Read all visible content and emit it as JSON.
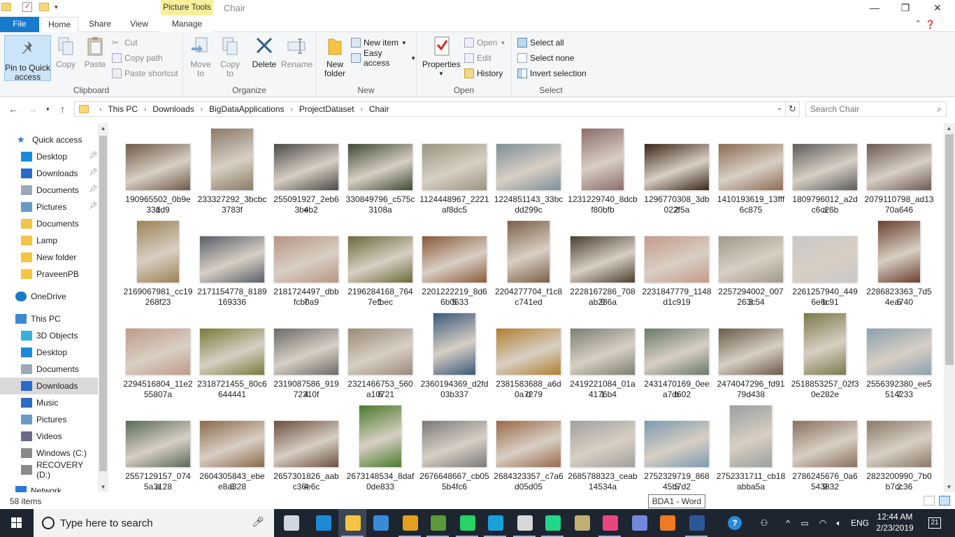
{
  "window": {
    "title": "Chair",
    "context_tab": "Picture Tools",
    "controls": {
      "minimize": "—",
      "maximize": "❐",
      "close": "✕"
    }
  },
  "ribbon_tabs": [
    {
      "label": "File"
    },
    {
      "label": "Home"
    },
    {
      "label": "Share"
    },
    {
      "label": "View"
    },
    {
      "label": "Manage"
    }
  ],
  "ribbon": {
    "clipboard": {
      "title": "Clipboard",
      "pin_label_1": "Pin to Quick",
      "pin_label_2": "access",
      "copy": "Copy",
      "paste": "Paste",
      "cut": "Cut",
      "copy_path": "Copy path",
      "paste_shortcut": "Paste shortcut"
    },
    "organize": {
      "title": "Organize",
      "move_1": "Move",
      "move_2": "to",
      "copy_1": "Copy",
      "copy_2": "to",
      "delete": "Delete",
      "rename": "Rename"
    },
    "new": {
      "title": "New",
      "new_folder_1": "New",
      "new_folder_2": "folder",
      "new_item": "New item",
      "easy_access": "Easy access"
    },
    "open": {
      "title": "Open",
      "properties": "Properties",
      "open": "Open",
      "edit": "Edit",
      "history": "History"
    },
    "select": {
      "title": "Select",
      "select_all": "Select all",
      "select_none": "Select none",
      "invert": "Invert selection"
    }
  },
  "address": {
    "crumbs": [
      "This PC",
      "Downloads",
      "BigDataApplications",
      "ProjectDataset",
      "Chair"
    ],
    "search_placeholder": "Search Chair"
  },
  "nav": {
    "items": [
      {
        "label": "Quick access",
        "icon": "star-icon",
        "pinned": false,
        "selected": false
      },
      {
        "label": "Desktop",
        "icon": "desktop-icon",
        "pinned": true,
        "selected": false
      },
      {
        "label": "Downloads",
        "icon": "download-icon",
        "pinned": true,
        "selected": false
      },
      {
        "label": "Documents",
        "icon": "documents-icon",
        "pinned": true,
        "selected": false
      },
      {
        "label": "Pictures",
        "icon": "pictures-icon",
        "pinned": true,
        "selected": false
      },
      {
        "label": "Documents",
        "icon": "folder-icon",
        "pinned": false,
        "selected": false
      },
      {
        "label": "Lamp",
        "icon": "folder-icon",
        "pinned": false,
        "selected": false
      },
      {
        "label": "New folder",
        "icon": "folder-icon",
        "pinned": false,
        "selected": false
      },
      {
        "label": "PraveenPB",
        "icon": "folder-icon",
        "pinned": false,
        "selected": false
      },
      {
        "label": "OneDrive",
        "icon": "cloud-icon",
        "pinned": false,
        "selected": false
      },
      {
        "label": "This PC",
        "icon": "computer-icon",
        "pinned": false,
        "selected": false
      },
      {
        "label": "3D Objects",
        "icon": "cube-icon",
        "pinned": false,
        "selected": false
      },
      {
        "label": "Desktop",
        "icon": "desktop-icon",
        "pinned": false,
        "selected": false
      },
      {
        "label": "Documents",
        "icon": "documents-icon",
        "pinned": false,
        "selected": false
      },
      {
        "label": "Downloads",
        "icon": "download-icon",
        "pinned": false,
        "selected": true
      },
      {
        "label": "Music",
        "icon": "music-icon",
        "pinned": false,
        "selected": false
      },
      {
        "label": "Pictures",
        "icon": "pictures-icon",
        "pinned": false,
        "selected": false
      },
      {
        "label": "Videos",
        "icon": "videos-icon",
        "pinned": false,
        "selected": false
      },
      {
        "label": "Windows (C:)",
        "icon": "drive-icon",
        "pinned": false,
        "selected": false
      },
      {
        "label": "RECOVERY (D:)",
        "icon": "drive-icon",
        "pinned": false,
        "selected": false
      },
      {
        "label": "Network",
        "icon": "network-icon",
        "pinned": false,
        "selected": false
      }
    ]
  },
  "files": [
    {
      "line1": "190965502_0b9ed",
      "line2": "331d9",
      "color": "#6d5a4a"
    },
    {
      "line1": "233327292_3bcbc",
      "line2": "3783f",
      "color": "#8a7a68"
    },
    {
      "line1": "255091927_2eb64",
      "line2": "3beb2",
      "color": "#4b4a46"
    },
    {
      "line1": "330849796_c575c",
      "line2": "3108a",
      "color": "#3e4a35"
    },
    {
      "line1": "1124448967_2221",
      "line2": "af8dc5",
      "color": "#9a9480"
    },
    {
      "line1": "1224851143_33bc",
      "line2": "dd299c",
      "color": "#7d8e99"
    },
    {
      "line1": "1231229740_8dcb",
      "line2": "f80bfb",
      "color": "#8d6d6a"
    },
    {
      "line1": "1296770308_3db2",
      "line2": "022f5a",
      "color": "#3a2618"
    },
    {
      "line1": "1410193619_13fff",
      "line2": "6c875",
      "color": "#8c6c55"
    },
    {
      "line1": "1809796012_a2da",
      "line2": "c6c26b",
      "color": "#5c5c5c"
    },
    {
      "line1": "2079110798_ad13",
      "line2": "70a646",
      "color": "#6b5a55"
    },
    {
      "line1": "2169067981_cc19",
      "line2": "268f23",
      "color": "#9b8357"
    },
    {
      "line1": "2171154778_8189",
      "line2": "169336",
      "color": "#5a5f6a"
    },
    {
      "line1": "2181724497_dbb7",
      "line2": "fcb0a9",
      "color": "#b89584"
    },
    {
      "line1": "2196284168_7641",
      "line2": "7efbec",
      "color": "#6a6a3a"
    },
    {
      "line1": "2201222219_8d65",
      "line2": "6b0633",
      "color": "#8a5a3a"
    },
    {
      "line1": "2204277704_f1c8",
      "line2": "c741ed",
      "color": "#7a6048"
    },
    {
      "line1": "2228167286_7089",
      "line2": "ab236a",
      "color": "#4a4030"
    },
    {
      "line1": "2231847779_1148",
      "line2": "d1c919",
      "color": "#c59a8a"
    },
    {
      "line1": "2257294002_0073",
      "line2": "263c54",
      "color": "#a09a8a"
    },
    {
      "line1": "2261257940_449b",
      "line2": "6e6c91",
      "color": "#c8c8c8"
    },
    {
      "line1": "2286823363_7d55",
      "line2": "4ea740",
      "color": "#6a4030"
    },
    {
      "line1": "2294516804_11e2",
      "line2": "55807a",
      "color": "#c09a8a"
    },
    {
      "line1": "2318721455_80c6",
      "line2": "644441",
      "color": "#7a7a3a"
    },
    {
      "line1": "2319087586_9194",
      "line2": "72310f",
      "color": "#6a6a6a"
    },
    {
      "line1": "2321466753_5606",
      "line2": "a10721",
      "color": "#9a8a7a"
    },
    {
      "line1": "2360194369_d2fd",
      "line2": "03b337",
      "color": "#3a5a7a"
    },
    {
      "line1": "2381583688_a6dd",
      "line2": "0a7279",
      "color": "#b08030"
    },
    {
      "line1": "2419221084_01a1",
      "line2": "4176b4",
      "color": "#7a8070"
    },
    {
      "line1": "2431470169_0eeb",
      "line2": "a7d602",
      "color": "#6a7a6a"
    },
    {
      "line1": "2474047296_fd91",
      "line2": "79d438",
      "color": "#6a5a4a"
    },
    {
      "line1": "2518853257_02f3",
      "line2": "0e282e",
      "color": "#7a7a4a"
    },
    {
      "line1": "2556392380_ee57",
      "line2": "514233",
      "color": "#8aa0b0"
    },
    {
      "line1": "2557129157_074a",
      "line2": "5a3128",
      "color": "#5a6a5a"
    },
    {
      "line1": "2604305843_ebe3",
      "line2": "e8a328",
      "color": "#8a6a4a"
    },
    {
      "line1": "2657301826_aab4",
      "line2": "c36e6c",
      "color": "#6a5040"
    },
    {
      "line1": "2673148534_8daf",
      "line2": "0de833",
      "color": "#4a7a2a"
    },
    {
      "line1": "2676648667_cb05",
      "line2": "5b4fc6",
      "color": "#7a7a7a"
    },
    {
      "line1": "2684323357_c7a6",
      "line2": "d05d05",
      "color": "#9a6a4a"
    },
    {
      "line1": "2685788323_ceab",
      "line2": "14534a",
      "color": "#a0a0a0"
    },
    {
      "line1": "2752329719_8685",
      "line2": "45b7d2",
      "color": "#7a9ab0"
    },
    {
      "line1": "2752331711_cb18",
      "line2": "abba5a",
      "color": "#9aa0a0"
    },
    {
      "line1": "2786245676_0a69",
      "line2": "543832",
      "color": "#8a7060"
    },
    {
      "line1": "2823200990_7b02",
      "line2": "b7cc36",
      "color": "#8a7a6a"
    }
  ],
  "status": {
    "item_count": "58 items"
  },
  "tooltip": "BDA1 - Word",
  "taskbar": {
    "search_placeholder": "Type here to search",
    "apps": [
      {
        "name": "task-view",
        "color": "#cfd8e0"
      },
      {
        "name": "edge",
        "color": "#1e8ad6"
      },
      {
        "name": "file-explorer",
        "color": "#f4c542"
      },
      {
        "name": "store",
        "color": "#3b8ad8"
      },
      {
        "name": "chrome",
        "color": "#e0a020"
      },
      {
        "name": "git",
        "color": "#5a9a3a"
      },
      {
        "name": "whatsapp",
        "color": "#25d366"
      },
      {
        "name": "webstorm",
        "color": "#1aa0d8"
      },
      {
        "name": "mail",
        "color": "#d8d8d8"
      },
      {
        "name": "pycharm",
        "color": "#21d789"
      },
      {
        "name": "paint",
        "color": "#c0b070"
      },
      {
        "name": "intellij",
        "color": "#e8467c"
      },
      {
        "name": "discord",
        "color": "#7289da"
      },
      {
        "name": "app-orange",
        "color": "#f07a20"
      },
      {
        "name": "word",
        "color": "#2b579a"
      }
    ],
    "language": "ENG",
    "time": "12:44 AM",
    "date": "2/23/2019",
    "notifications": "21"
  }
}
